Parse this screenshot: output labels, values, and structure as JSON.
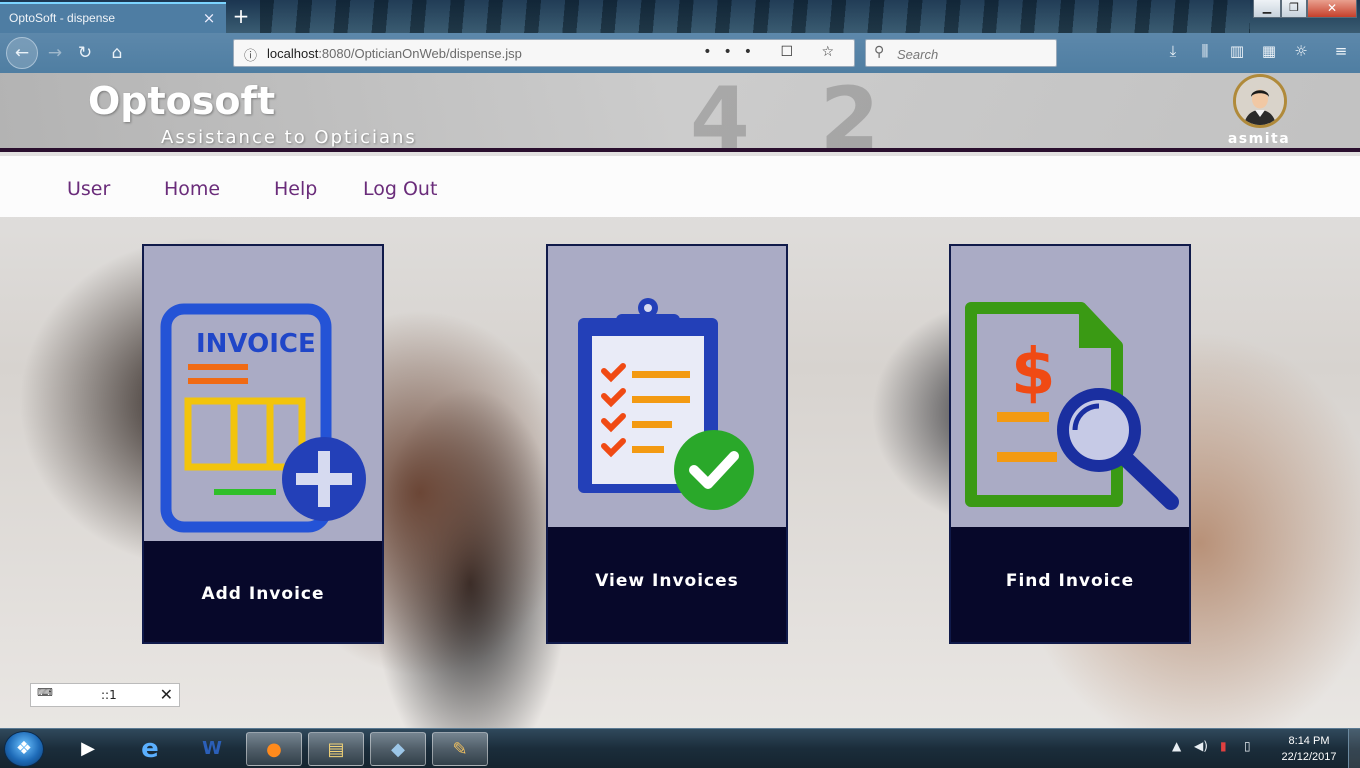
{
  "browser": {
    "tab_title": "OptoSoft - dispense",
    "tab_close": "×",
    "new_tab": "+",
    "url_host": "localhost",
    "url_rest": ":8080/OpticianOnWeb/dispense.jsp",
    "url_actions": "••• ☐ ☆",
    "search_placeholder": "Search",
    "window_min": "▁",
    "window_max": "❐",
    "window_close": "✕"
  },
  "header": {
    "brand": "Optosoft",
    "tagline": "Assistance to Opticians",
    "username": "asmita"
  },
  "menu": {
    "items": [
      "User",
      "Home",
      "Help",
      "Log Out"
    ]
  },
  "cards": [
    {
      "label": "Add Invoice",
      "image_label": "INVOICE",
      "icon": "add-invoice-icon"
    },
    {
      "label": "View Invoices",
      "icon": "clipboard-check-icon"
    },
    {
      "label": "Find Invoice",
      "icon": "find-invoice-icon"
    }
  ],
  "ime_widget": {
    "icon_text": "⌨",
    "text": "::1",
    "close": "✕"
  },
  "taskbar": {
    "time": "8:14 PM",
    "date": "22/12/2017"
  },
  "colors": {
    "menu_text": "#6a2c7a",
    "card_bg": "#07082a",
    "header_border": "#2a0f2e"
  }
}
